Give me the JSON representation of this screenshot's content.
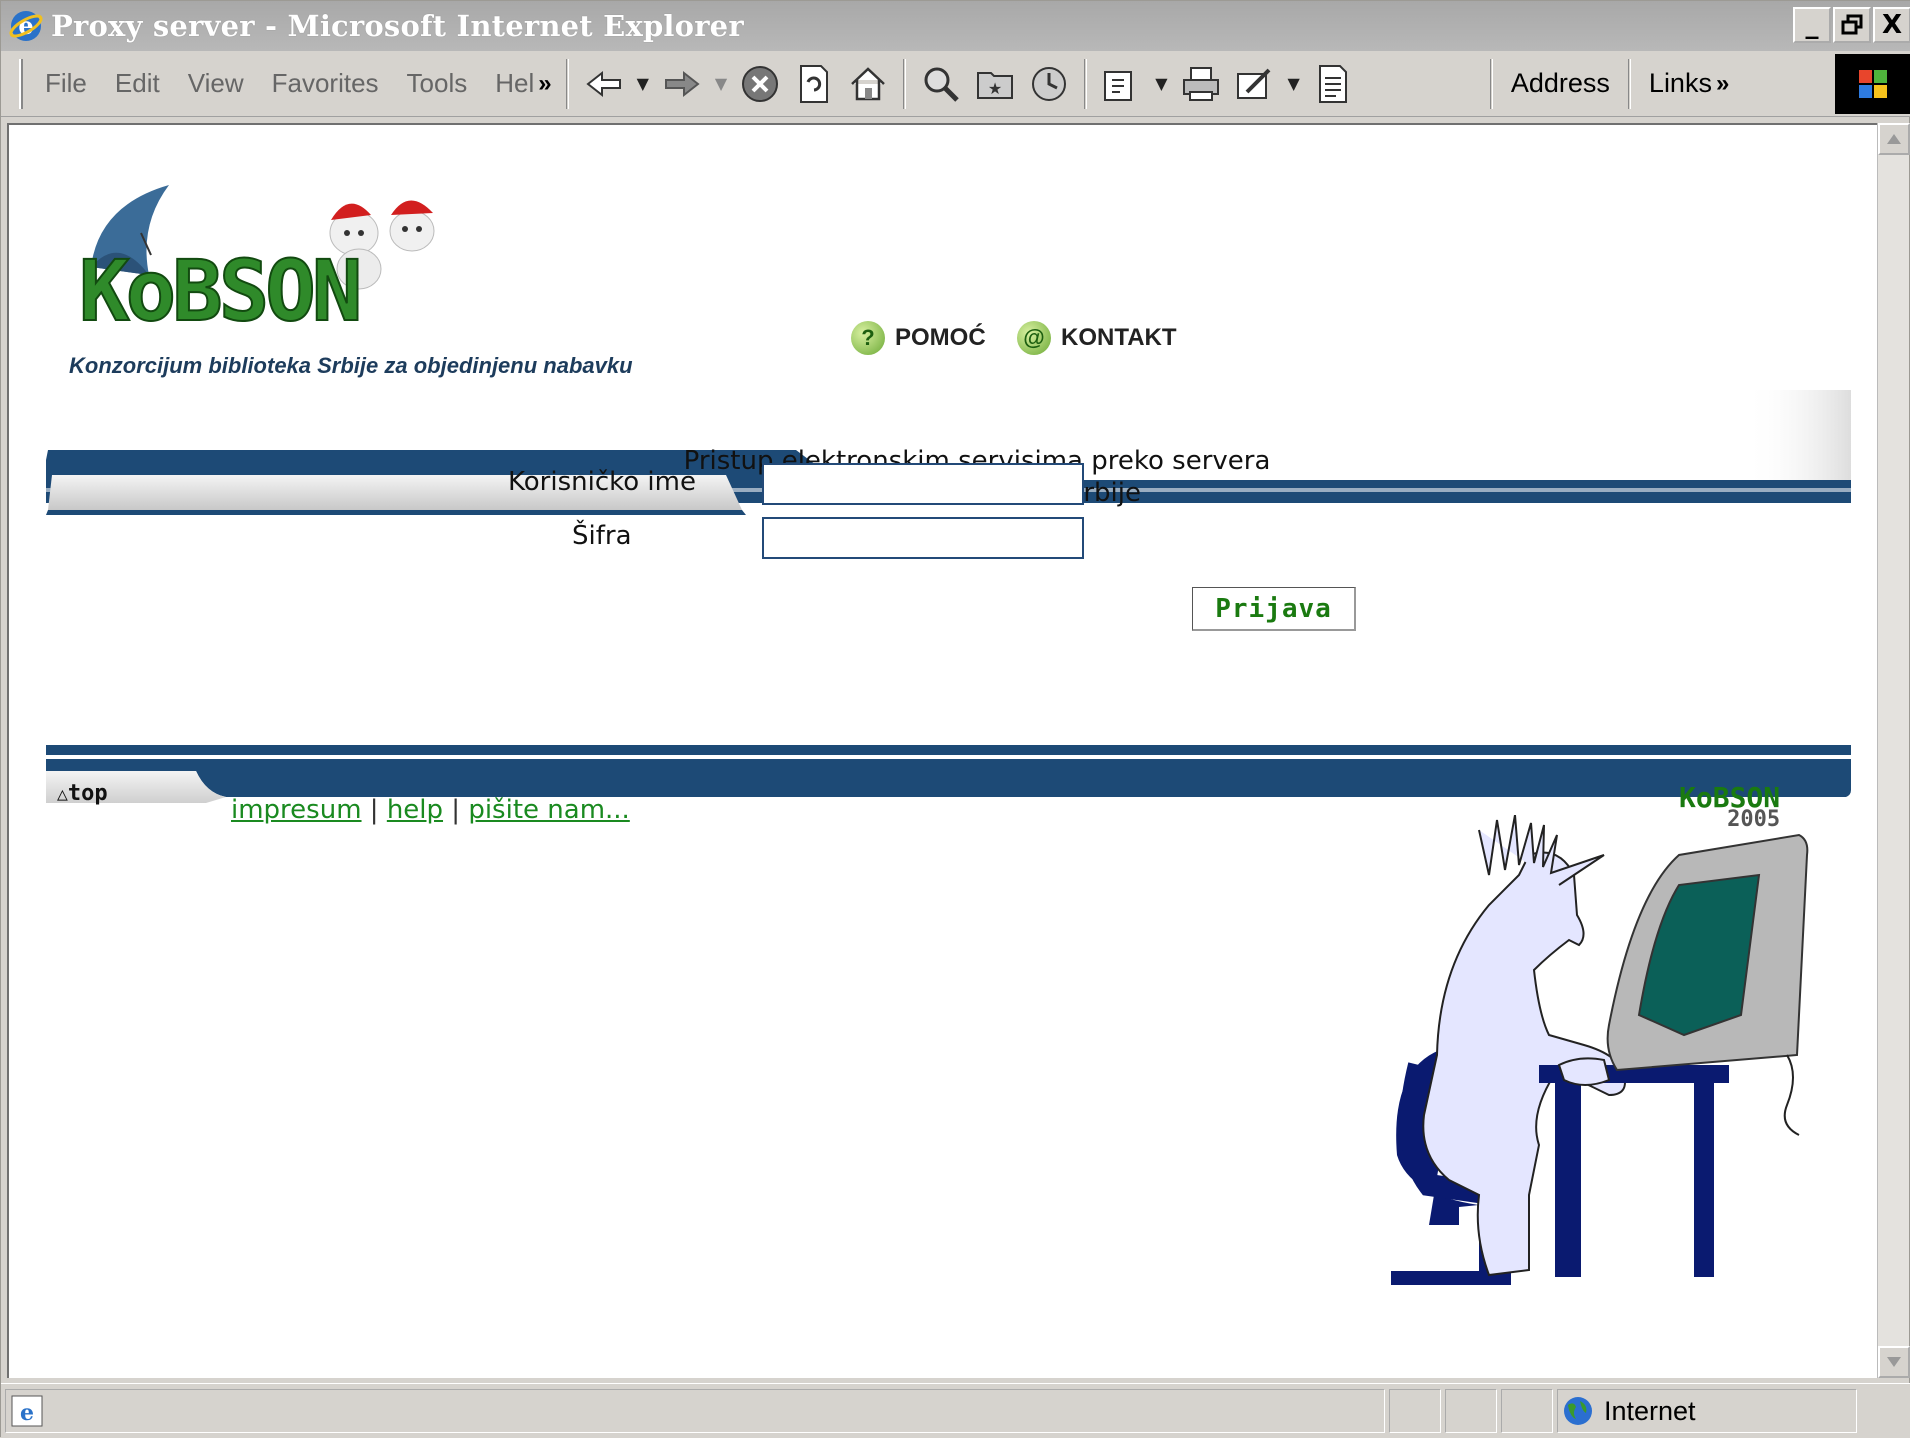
{
  "window": {
    "title": "Proxy server - Microsoft Internet Explorer",
    "minimize": "_",
    "restore": "ô",
    "close": "X"
  },
  "menu": [
    "File",
    "Edit",
    "View",
    "Favorites",
    "Tools",
    "Hel"
  ],
  "chevron": "»",
  "toolbar": {
    "address_label": "Address",
    "links_label": "Links",
    "icons": [
      "back-icon",
      "forward-icon",
      "stop-icon",
      "refresh-icon",
      "home-icon",
      "search-icon",
      "favorites-icon",
      "history-icon",
      "mail-icon",
      "print-icon",
      "edit-icon",
      "discuss-icon"
    ]
  },
  "page": {
    "logo_text": "KoBSON",
    "subtitle": "Konzorcijum biblioteka Srbije za objedinjenu nabavku",
    "nav": [
      {
        "icon": "?",
        "label": "POMOĆ"
      },
      {
        "icon": "@",
        "label": "KONTAKT"
      }
    ],
    "intro_line1": "Pristup elektronskim servisima preko servera",
    "intro_line2": "Narodne biblioteke Srbije",
    "form": {
      "username_label": "Korisničko ime",
      "password_label": "Šifra",
      "submit_label": "Prijava"
    },
    "footer": {
      "top_label": "top",
      "links": [
        "impresum",
        "help",
        "pišite nam..."
      ],
      "logo_line1": "KoBSON",
      "logo_line2": "2005"
    }
  },
  "statusbar": {
    "zone": "Internet"
  },
  "colors": {
    "brand_blue": "#1d4a76",
    "brand_green": "#2f8a2a",
    "link_green": "#1a8a20"
  }
}
